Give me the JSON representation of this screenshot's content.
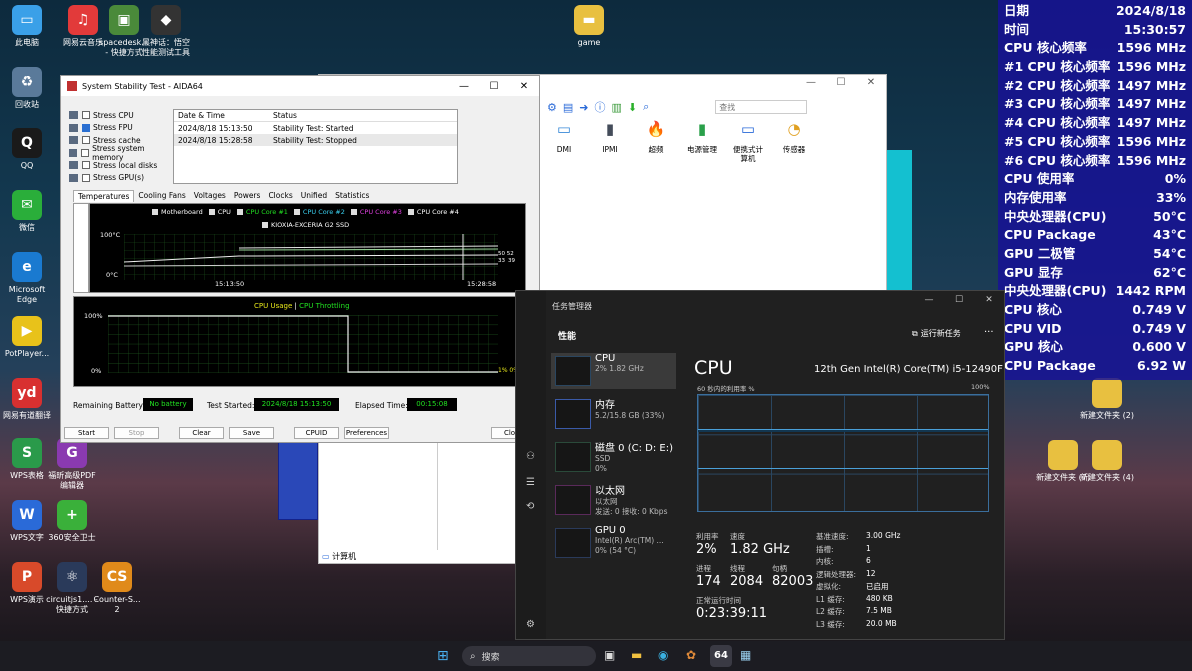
{
  "desktop_icons": [
    {
      "label": "此电脑",
      "color": "#3aa0e8",
      "glyph": "▭"
    },
    {
      "label": "网易云音乐",
      "color": "#e23a3a",
      "glyph": "♫"
    },
    {
      "label": "spacedesk... - 快捷方式",
      "color": "#4a8a3a",
      "glyph": "▣"
    },
    {
      "label": "黑神话：悟空 性能测试工具",
      "color": "#333333",
      "glyph": "◆"
    },
    {
      "label": "回收站",
      "color": "#5a7a9a",
      "glyph": "♻"
    },
    {
      "label": "QQ",
      "color": "#1a1a1a",
      "glyph": "Q"
    },
    {
      "label": "微信",
      "color": "#2aae3a",
      "glyph": "✉"
    },
    {
      "label": "Microsoft Edge",
      "color": "#1a7ad0",
      "glyph": "e"
    },
    {
      "label": "PotPlayer...",
      "color": "#e8c21a",
      "glyph": "▶"
    },
    {
      "label": "网易有道翻译",
      "color": "#d83030",
      "glyph": "yd"
    },
    {
      "label": "WPS表格",
      "color": "#2a9a4a",
      "glyph": "S"
    },
    {
      "label": "福昕高级PDF 编辑器",
      "color": "#8a3ab0",
      "glyph": "G"
    },
    {
      "label": "WPS文字",
      "color": "#2a6ad8",
      "glyph": "W"
    },
    {
      "label": "360安全卫士",
      "color": "#3ab03a",
      "glyph": "+"
    },
    {
      "label": "WPS演示",
      "color": "#d84a2a",
      "glyph": "P"
    },
    {
      "label": "circuitjs1.... - 快捷方式",
      "color": "#2a3a5a",
      "glyph": "⚛"
    },
    {
      "label": "Counter-S... 2",
      "color": "#e08a1a",
      "glyph": "CS"
    },
    {
      "label": "game",
      "color": "#e8c040",
      "glyph": "▬"
    },
    {
      "label": "新建文件夹 (2)",
      "color": "#e8c040",
      "glyph": ""
    },
    {
      "label": "新建文件夹 (7)",
      "color": "#e8c040",
      "glyph": ""
    },
    {
      "label": "新建文件夹 (4)",
      "color": "#e8c040",
      "glyph": ""
    }
  ],
  "overlay": {
    "rows": [
      {
        "label": "日期",
        "value": "2024/8/18",
        "color": "white"
      },
      {
        "label": "时间",
        "value": "15:30:57",
        "color": "white"
      },
      {
        "label": "CPU 核心频率",
        "value": "1596 MHz",
        "color": "white"
      },
      {
        "label": "#1 CPU 核心频率",
        "value": "1596 MHz",
        "color": "white"
      },
      {
        "label": "#2 CPU 核心频率",
        "value": "1497 MHz",
        "color": "white"
      },
      {
        "label": "#3 CPU 核心频率",
        "value": "1497 MHz",
        "color": "white"
      },
      {
        "label": "#4 CPU 核心频率",
        "value": "1497 MHz",
        "color": "white"
      },
      {
        "label": "#5 CPU 核心频率",
        "value": "1596 MHz",
        "color": "white"
      },
      {
        "label": "#6 CPU 核心频率",
        "value": "1596 MHz",
        "color": "white"
      },
      {
        "label": "CPU 使用率",
        "value": "0%",
        "color": "white"
      },
      {
        "label": "内存使用率",
        "value": "33%",
        "color": "white"
      },
      {
        "label": "中央处理器(CPU)",
        "value": "50°C",
        "color": "green"
      },
      {
        "label": "CPU Package",
        "value": "43°C",
        "color": "green"
      },
      {
        "label": "GPU 二极管",
        "value": "54°C",
        "color": "green"
      },
      {
        "label": "GPU 显存",
        "value": "62°C",
        "color": "green"
      },
      {
        "label": "中央处理器(CPU)",
        "value": "1442 RPM",
        "color": "red"
      },
      {
        "label": "CPU 核心",
        "value": "0.749 V",
        "color": "cyan"
      },
      {
        "label": "CPU VID",
        "value": "0.749 V",
        "color": "cyan"
      },
      {
        "label": "GPU 核心",
        "value": "0.600 V",
        "color": "cyan"
      },
      {
        "label": "CPU Package",
        "value": "6.92 W",
        "color": "white"
      }
    ]
  },
  "aida": {
    "title": "System Stability Test - AIDA64",
    "stress": [
      {
        "label": "Stress CPU",
        "checked": false
      },
      {
        "label": "Stress FPU",
        "checked": true
      },
      {
        "label": "Stress cache",
        "checked": false
      },
      {
        "label": "Stress system memory",
        "checked": false
      },
      {
        "label": "Stress local disks",
        "checked": false
      },
      {
        "label": "Stress GPU(s)",
        "checked": false
      }
    ],
    "log_headers": [
      "Date & Time",
      "Status"
    ],
    "log_rows": [
      {
        "time": "2024/8/18 15:13:50",
        "status": "Stability Test: Started"
      },
      {
        "time": "2024/8/18 15:28:58",
        "status": "Stability Test: Stopped"
      }
    ],
    "tabs": [
      "Temperatures",
      "Cooling Fans",
      "Voltages",
      "Powers",
      "Clocks",
      "Unified",
      "Statistics"
    ],
    "temp_legend": [
      "Motherboard",
      "CPU",
      "CPU Core #1",
      "CPU Core #2",
      "CPU Core #3",
      "CPU Core #4"
    ],
    "temp_legend2": "KIOXIA-EXCERIA G2 SSD",
    "temp_y_top": "100°C",
    "temp_y_bot": "0°C",
    "temp_x_left": "15:13:50",
    "temp_x_right": "15:28:58",
    "temp_end_vals": "50 52",
    "temp_end_vals2": "33",
    "temp_end_vals3": "39",
    "usage_title_a": "CPU Usage",
    "usage_sep": "|",
    "usage_title_b": "CPU Throttling",
    "usage_y_top": "100%",
    "usage_y_bot": "0%",
    "usage_end": "1% 0%",
    "remaining_battery_label": "Remaining Battery:",
    "remaining_battery": "No battery",
    "test_started_label": "Test Started:",
    "test_started": "2024/8/18 15:13:50",
    "elapsed_label": "Elapsed Time:",
    "elapsed": "00:15:08",
    "buttons": {
      "start": "Start",
      "stop": "Stop",
      "clear": "Clear",
      "save": "Save",
      "cpuid": "CPUID",
      "preferences": "Preferences",
      "close": "Close"
    }
  },
  "explorer": {
    "search_placeholder": "查找",
    "items": [
      "DMI",
      "IPMI",
      "超频",
      "电源管理",
      "便携式计算机",
      "传感器"
    ],
    "statusbar": "计算机"
  },
  "taskmgr": {
    "title": "任务管理器",
    "section": "性能",
    "run_task": "运行新任务",
    "more": "···",
    "perf_items": [
      {
        "name": "CPU",
        "sub1": "2% 1.82 GHz",
        "sub2": ""
      },
      {
        "name": "内存",
        "sub1": "5.2/15.8 GB (33%)",
        "sub2": ""
      },
      {
        "name": "磁盘 0 (C: D: E:)",
        "sub1": "SSD",
        "sub2": "0%"
      },
      {
        "name": "以太网",
        "sub1": "以太网",
        "sub2": "发送: 0 接收: 0 Kbps"
      },
      {
        "name": "GPU 0",
        "sub1": "Intel(R) Arc(TM) ...",
        "sub2": "0% (54 °C)"
      }
    ],
    "heading": "CPU",
    "cpu_model": "12th Gen Intel(R) Core(TM) i5-12490F",
    "graph_label": "60 秒内的利用率 %",
    "graph_max": "100%",
    "util_label": "利用率",
    "util": "2%",
    "speed_label": "速度",
    "speed": "1.82 GHz",
    "proc_label": "进程",
    "proc": "174",
    "thread_label": "线程",
    "thread": "2084",
    "handle_label": "句柄",
    "handle": "82003",
    "uptime_label": "正常运行时间",
    "uptime": "0:23:39:11",
    "specs": [
      {
        "k": "基准速度:",
        "v": "3.00 GHz"
      },
      {
        "k": "插槽:",
        "v": "1"
      },
      {
        "k": "内核:",
        "v": "6"
      },
      {
        "k": "逻辑处理器:",
        "v": "12"
      },
      {
        "k": "虚拟化:",
        "v": "已启用"
      },
      {
        "k": "L1 缓存:",
        "v": "480 KB"
      },
      {
        "k": "L2 缓存:",
        "v": "7.5 MB"
      },
      {
        "k": "L3 缓存:",
        "v": "20.0 MB"
      }
    ]
  },
  "taskbar": {
    "search": "搜索",
    "pinned": [
      "task-view",
      "file-explorer",
      "edge",
      "browser",
      "aida64",
      "task-manager"
    ],
    "aida_label": "64"
  }
}
